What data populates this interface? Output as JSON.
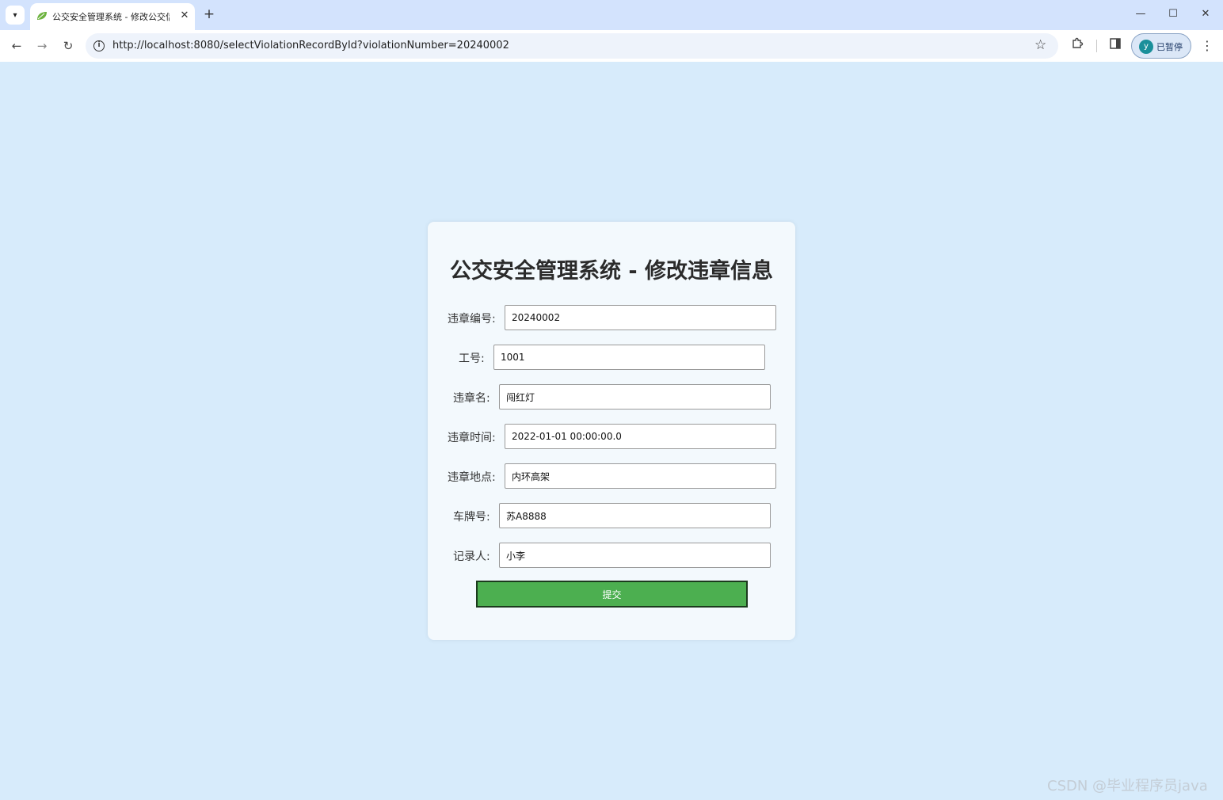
{
  "browser": {
    "tab_title": "公交安全管理系统 - 修改公交信",
    "tab_close": "✕",
    "new_tab": "+",
    "url": "http://localhost:8080/selectViolationRecordById?violationNumber=20240002",
    "profile_initial": "y",
    "profile_status": "已暂停",
    "icons": {
      "tab_list": "chevron-down-icon",
      "back": "back-arrow-icon",
      "forward": "forward-arrow-icon",
      "reload": "reload-icon",
      "site_info": "info-icon",
      "bookmark": "star-icon",
      "extensions": "puzzle-icon",
      "side_panel": "side-panel-icon",
      "menu": "menu-dots-icon",
      "minimize": "minimize-icon",
      "maximize": "maximize-icon",
      "close": "close-icon"
    }
  },
  "page": {
    "title": "公交安全管理系统 - 修改违章信息",
    "fields": {
      "violation_number": {
        "label": "违章编号:",
        "value": "20240002"
      },
      "employee_id": {
        "label": "工号:",
        "value": "1001"
      },
      "violation_name": {
        "label": "违章名:",
        "value": "闯红灯"
      },
      "violation_time": {
        "label": "违章时间:",
        "value": "2022-01-01 00:00:00.0"
      },
      "violation_location": {
        "label": "违章地点:",
        "value": "内环高架"
      },
      "license_plate": {
        "label": "车牌号:",
        "value": "苏A8888"
      },
      "recorder": {
        "label": "记录人:",
        "value": "小李"
      }
    },
    "submit_label": "提交"
  },
  "watermark": "CSDN @毕业程序员java",
  "colors": {
    "page_background": "#d7ebfb",
    "card_background": "#f3f9fd",
    "submit_button": "#4caf50",
    "tab_strip": "#d3e3fd"
  }
}
